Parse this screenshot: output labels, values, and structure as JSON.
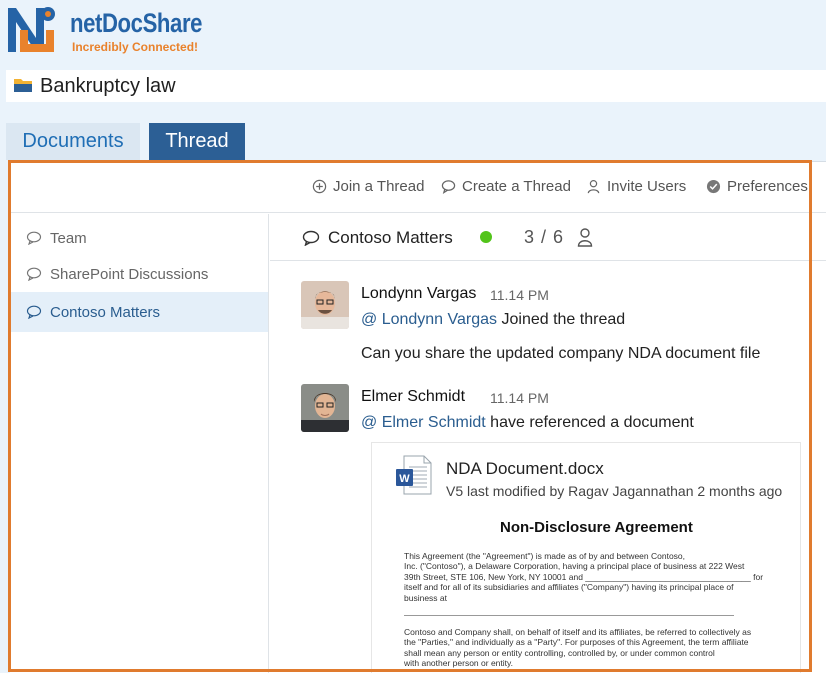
{
  "brand": {
    "name": "netDocShare",
    "tagline": "Incredibly Connected!"
  },
  "library": {
    "title": "Bankruptcy law",
    "icon": "folder-icon"
  },
  "tabs": [
    {
      "label": "Documents",
      "active": false
    },
    {
      "label": "Thread",
      "active": true
    }
  ],
  "toolbar": {
    "join": "Join a Thread",
    "create": "Create a Thread",
    "invite": "Invite Users",
    "preferences": "Preferences"
  },
  "sidebar": {
    "items": [
      {
        "label": "Team",
        "icon": "chat-bubble-icon"
      },
      {
        "label": "SharePoint Discussions",
        "icon": "chat-bubble-icon"
      },
      {
        "label": "Contoso Matters",
        "icon": "chat-bubble-icon",
        "active": true
      }
    ]
  },
  "thread": {
    "title": "Contoso Matters",
    "count": "3 / 6",
    "status_color": "#52c41a"
  },
  "messages": [
    {
      "author": "Londynn Vargas",
      "time": "11.14 PM",
      "mention": "@ Londynn Vargas",
      "action": "Joined the thread",
      "text": "Can you share the updated company NDA document file"
    },
    {
      "author": "Elmer Schmidt",
      "time": "11.14 PM",
      "mention": "@ Elmer Schmidt",
      "action": "have referenced a document"
    }
  ],
  "document": {
    "name": "NDA Document.docx",
    "meta": "V5 last modified by Ragav Jagannathan 2 months ago",
    "preview_title": "Non-Disclosure Agreement",
    "preview_para1": "This Agreement (the \"Agreement\") is made as of                              by and between Contoso,\nInc. (\"Contoso\"), a Delaware Corporation, having a principal place of business at 222 West\n39th Street, STE 106, New York, NY 10001 and ___________________________________ for\nitself and for all of its subsidiaries and affiliates (\"Company\") having its principal place of\nbusiness at",
    "preview_para2": "Contoso and Company shall, on behalf of itself and its affiliates, be referred to collectively as\nthe \"Parties,\" and individually as a \"Party\". For purposes of this Agreement, the term affiliate\nshall mean any person or entity controlling, controlled by, or under common control\nwith another person or entity."
  },
  "colors": {
    "accent": "#2c5f95",
    "highlight_border": "#e07b2e",
    "mention": "#2a5d8f"
  }
}
